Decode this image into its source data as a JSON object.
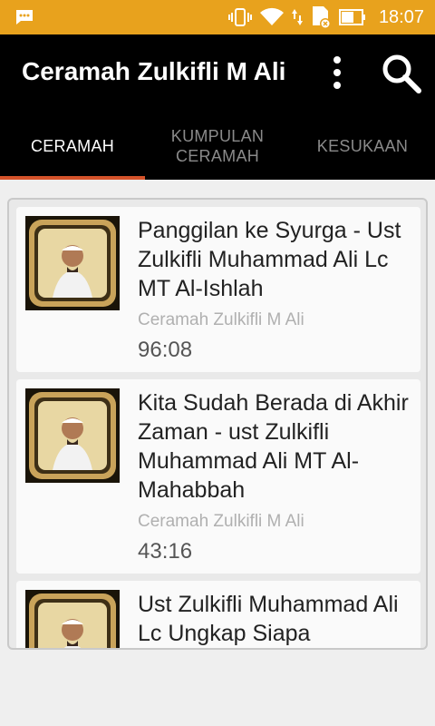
{
  "status_bar": {
    "time": "18:07",
    "bg_color": "#e8a21d",
    "icons": [
      "message-icon",
      "vibrate-icon",
      "wifi-icon",
      "data-arrows-icon",
      "sd-card-icon",
      "battery-icon"
    ]
  },
  "app_bar": {
    "title": "Ceramah Zulkifli M Ali",
    "menu_icon": "overflow-menu-icon",
    "search_icon": "search-icon"
  },
  "tabs": [
    {
      "label": "CERAMAH",
      "active": true
    },
    {
      "label": "KUMPULAN\nCERAMAH",
      "active": false
    },
    {
      "label": "KESUKAAN",
      "active": false
    }
  ],
  "accent_color": "#d5532a",
  "items": [
    {
      "title": "Panggilan ke Syurga - Ust Zulkifli Muhammad Ali Lc MT Al-Ishlah",
      "subtitle": "Ceramah Zulkifli M Ali",
      "duration": "96:08"
    },
    {
      "title": "Kita Sudah Berada di Akhir Zaman - ust Zulkifli Muhammad Ali MT Al-Mahabbah",
      "subtitle": "Ceramah Zulkifli M Ali",
      "duration": "43:16"
    },
    {
      "title": "Ust Zulkifli Muhammad Ali Lc Ungkap Siapa",
      "subtitle": "",
      "duration": ""
    }
  ]
}
